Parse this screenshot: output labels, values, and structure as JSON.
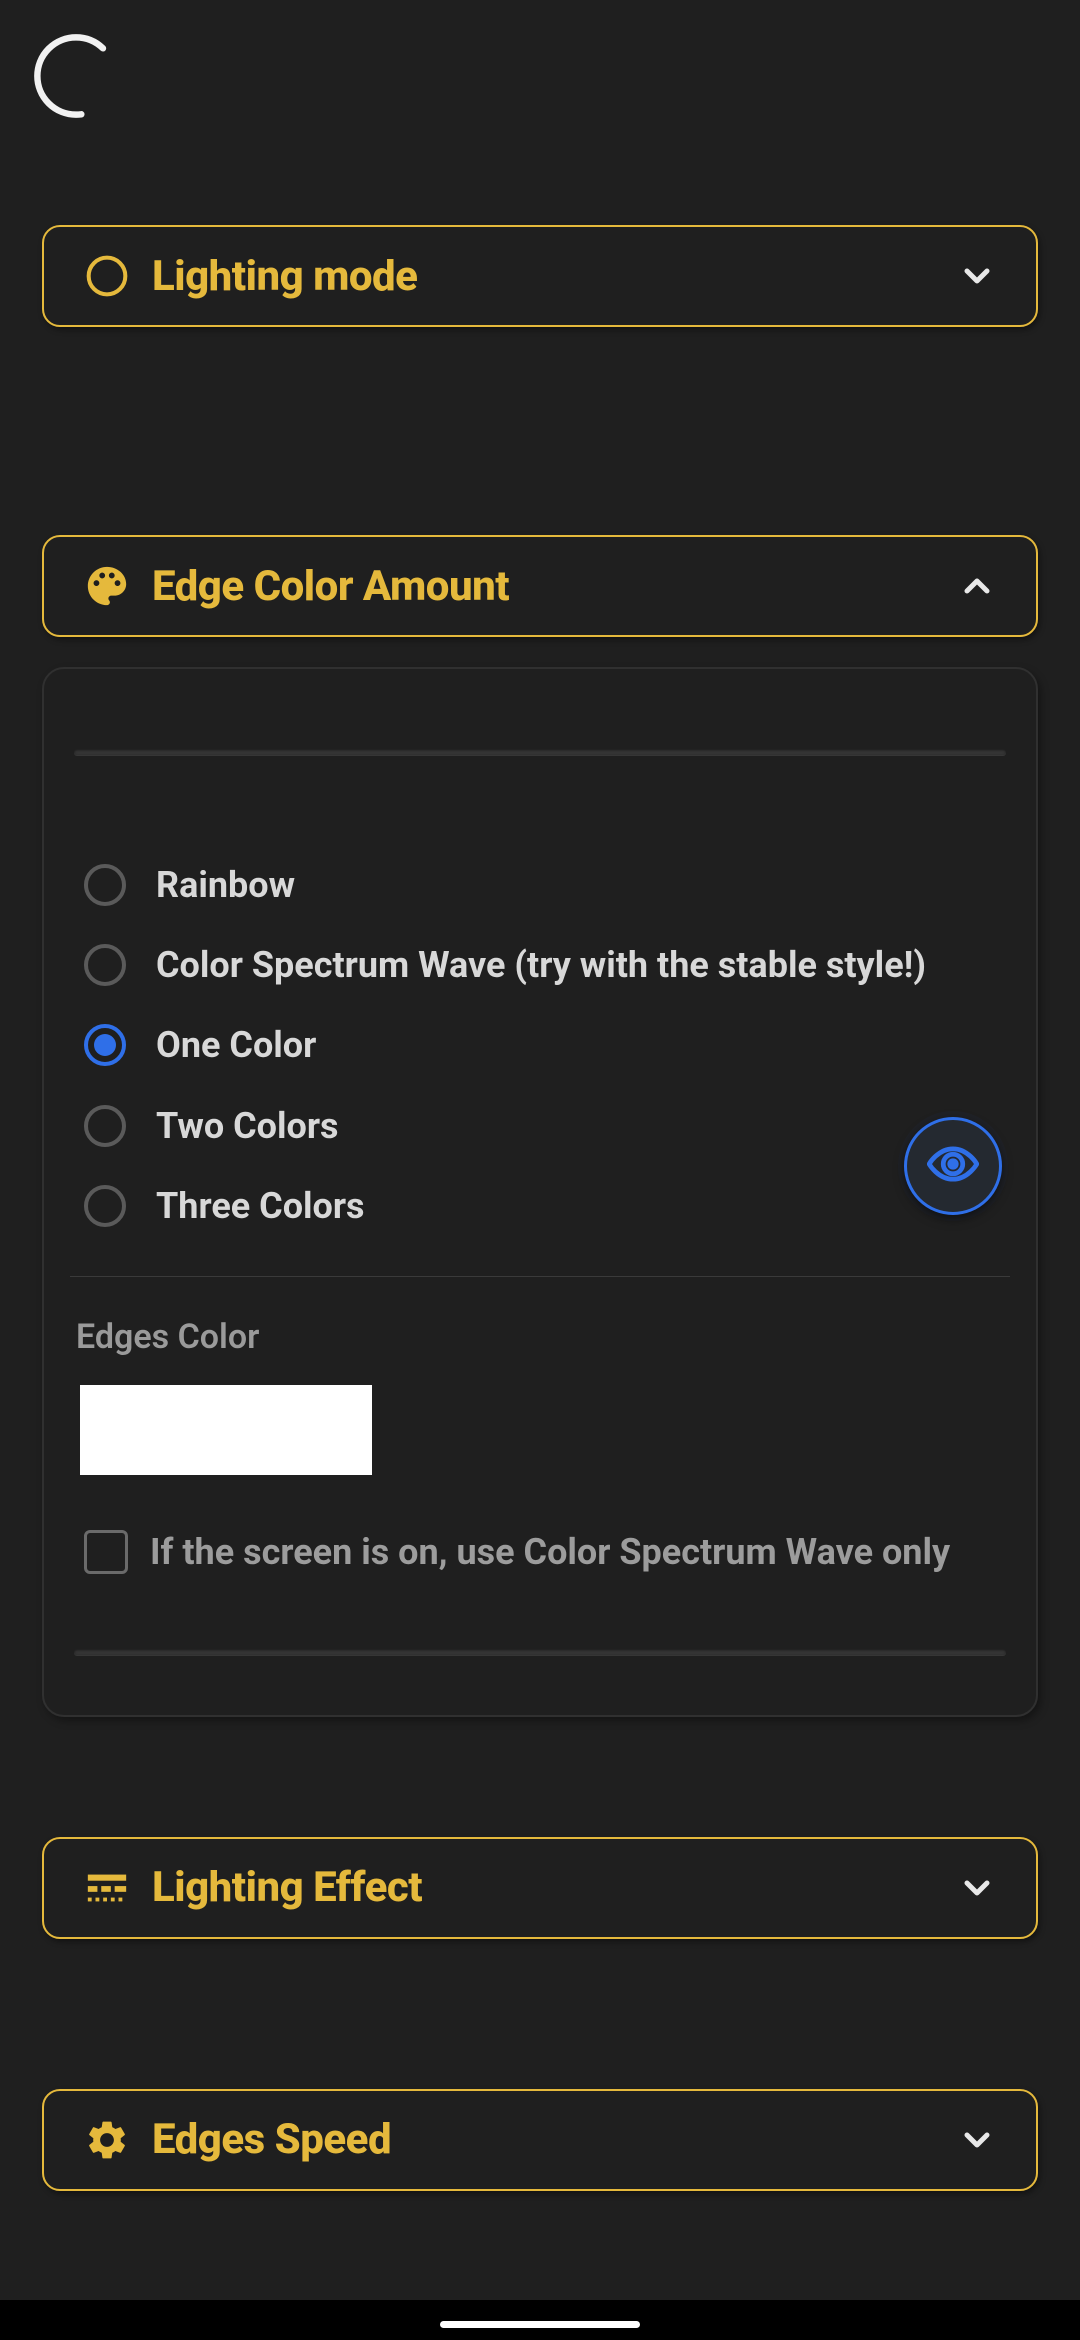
{
  "sections": {
    "lighting_mode": {
      "title": "Lighting mode",
      "expanded": false
    },
    "edge_color_amount": {
      "title": "Edge Color Amount",
      "expanded": true
    },
    "lighting_effect": {
      "title": "Lighting Effect",
      "expanded": false
    },
    "edges_speed": {
      "title": "Edges Speed",
      "expanded": false
    }
  },
  "edge_color_panel": {
    "radio_options": {
      "rainbow": "Rainbow",
      "color_spectrum_wave": "Color Spectrum Wave (try with the stable style!)",
      "one_color": "One Color",
      "two_colors": "Two Colors",
      "three_colors": "Three Colors"
    },
    "selected": "one_color",
    "edges_color_label": "Edges Color",
    "edges_color_value": "#FFFFFF",
    "screen_on_checkbox_label": "If the screen is on, use Color Spectrum Wave only",
    "screen_on_checked": false
  },
  "colors": {
    "accent": "#e5b93c",
    "radio_selected": "#2f6fe8"
  }
}
